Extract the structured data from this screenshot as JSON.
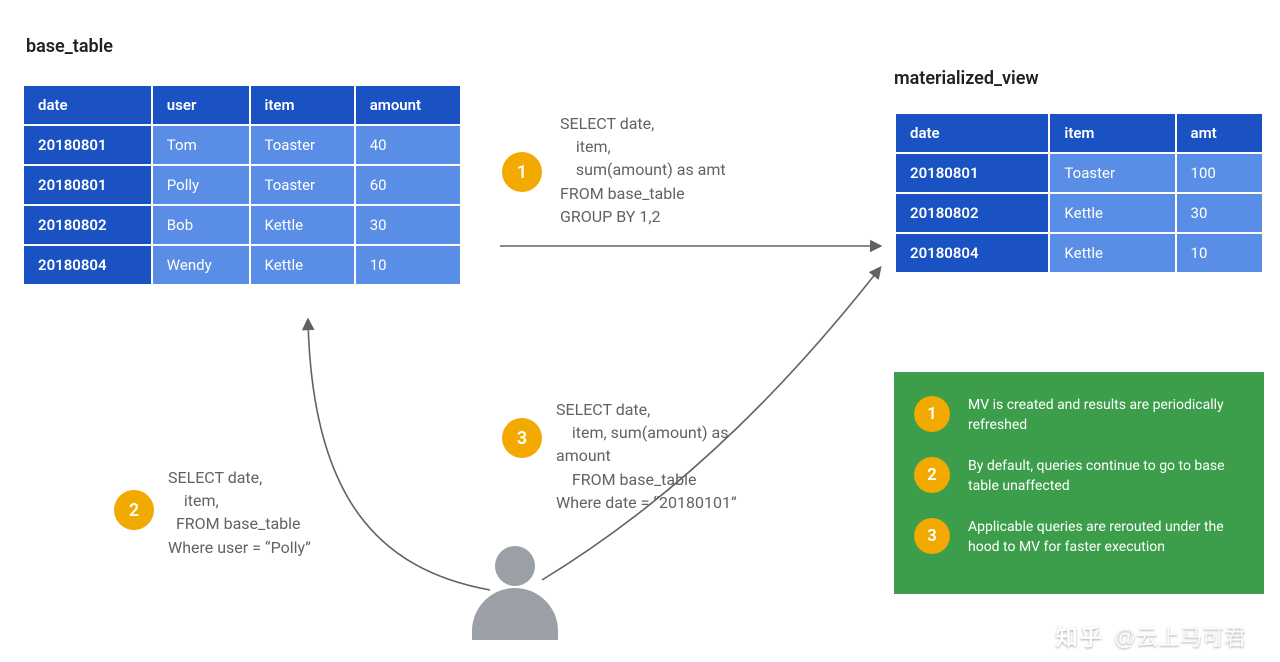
{
  "titles": {
    "base_table": "base_table",
    "materialized_view": "materialized_view"
  },
  "base_table": {
    "headers": [
      "date",
      "user",
      "item",
      "amount"
    ],
    "rows": [
      [
        "20180801",
        "Tom",
        "Toaster",
        "40"
      ],
      [
        "20180801",
        "Polly",
        "Toaster",
        "60"
      ],
      [
        "20180802",
        "Bob",
        "Kettle",
        "30"
      ],
      [
        "20180804",
        "Wendy",
        "Kettle",
        "10"
      ]
    ]
  },
  "materialized_view": {
    "headers": [
      "date",
      "item",
      "amt"
    ],
    "rows": [
      [
        "20180801",
        "Toaster",
        "100"
      ],
      [
        "20180802",
        "Kettle",
        "30"
      ],
      [
        "20180804",
        "Kettle",
        "10"
      ]
    ]
  },
  "sql": {
    "q1": "SELECT date,\n    item,\n    sum(amount) as amt\nFROM base_table\nGROUP BY 1,2",
    "q2": "SELECT date,\n    item,\n  FROM base_table\nWhere user = “Polly”",
    "q3": "SELECT date,\n    item, sum(amount) as\namount\n    FROM base_table\nWhere date = “20180101”"
  },
  "badges": {
    "b1": "1",
    "b2": "2",
    "b3": "3"
  },
  "legend": {
    "items": [
      {
        "num": "1",
        "text": "MV is created and results are periodically refreshed"
      },
      {
        "num": "2",
        "text": "By default, queries continue to go to base table unaffected"
      },
      {
        "num": "3",
        "text": "Applicable queries are rerouted under the hood to MV for faster execution"
      }
    ]
  },
  "watermark": {
    "site": "知乎",
    "author": "@云上马可君"
  }
}
